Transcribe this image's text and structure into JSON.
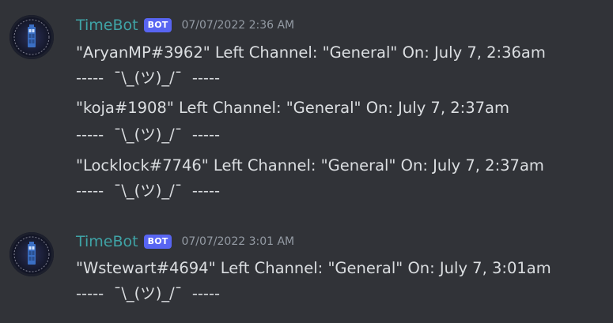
{
  "groups": [
    {
      "author": "TimeBot",
      "badge": "BOT",
      "timestamp": "07/07/2022 2:36 AM",
      "messages": [
        {
          "line1": "\"AryanMP#3962\" Left Channel: \"General\" On: July 7, 2:36am",
          "line2": "-----  ¯\\_(ツ)_/¯  -----"
        },
        {
          "line1": "\"koja#1908\" Left Channel: \"General\" On: July 7, 2:37am",
          "line2": "-----  ¯\\_(ツ)_/¯  -----"
        },
        {
          "line1": "\"Locklock#7746\" Left Channel: \"General\" On: July 7, 2:37am",
          "line2": "-----  ¯\\_(ツ)_/¯  -----"
        }
      ]
    },
    {
      "author": "TimeBot",
      "badge": "BOT",
      "timestamp": "07/07/2022 3:01 AM",
      "messages": [
        {
          "line1": "\"Wstewart#4694\" Left Channel: \"General\" On: July 7, 3:01am",
          "line2": "-----  ¯\\_(ツ)_/¯  -----"
        }
      ]
    }
  ],
  "colors": {
    "background": "#313338",
    "username": "#3fa3a6",
    "badge": "#5865f2",
    "timestamp": "#949ba4",
    "text": "#dbdee1"
  },
  "icons": {
    "avatar": "tardis-avatar-icon"
  }
}
